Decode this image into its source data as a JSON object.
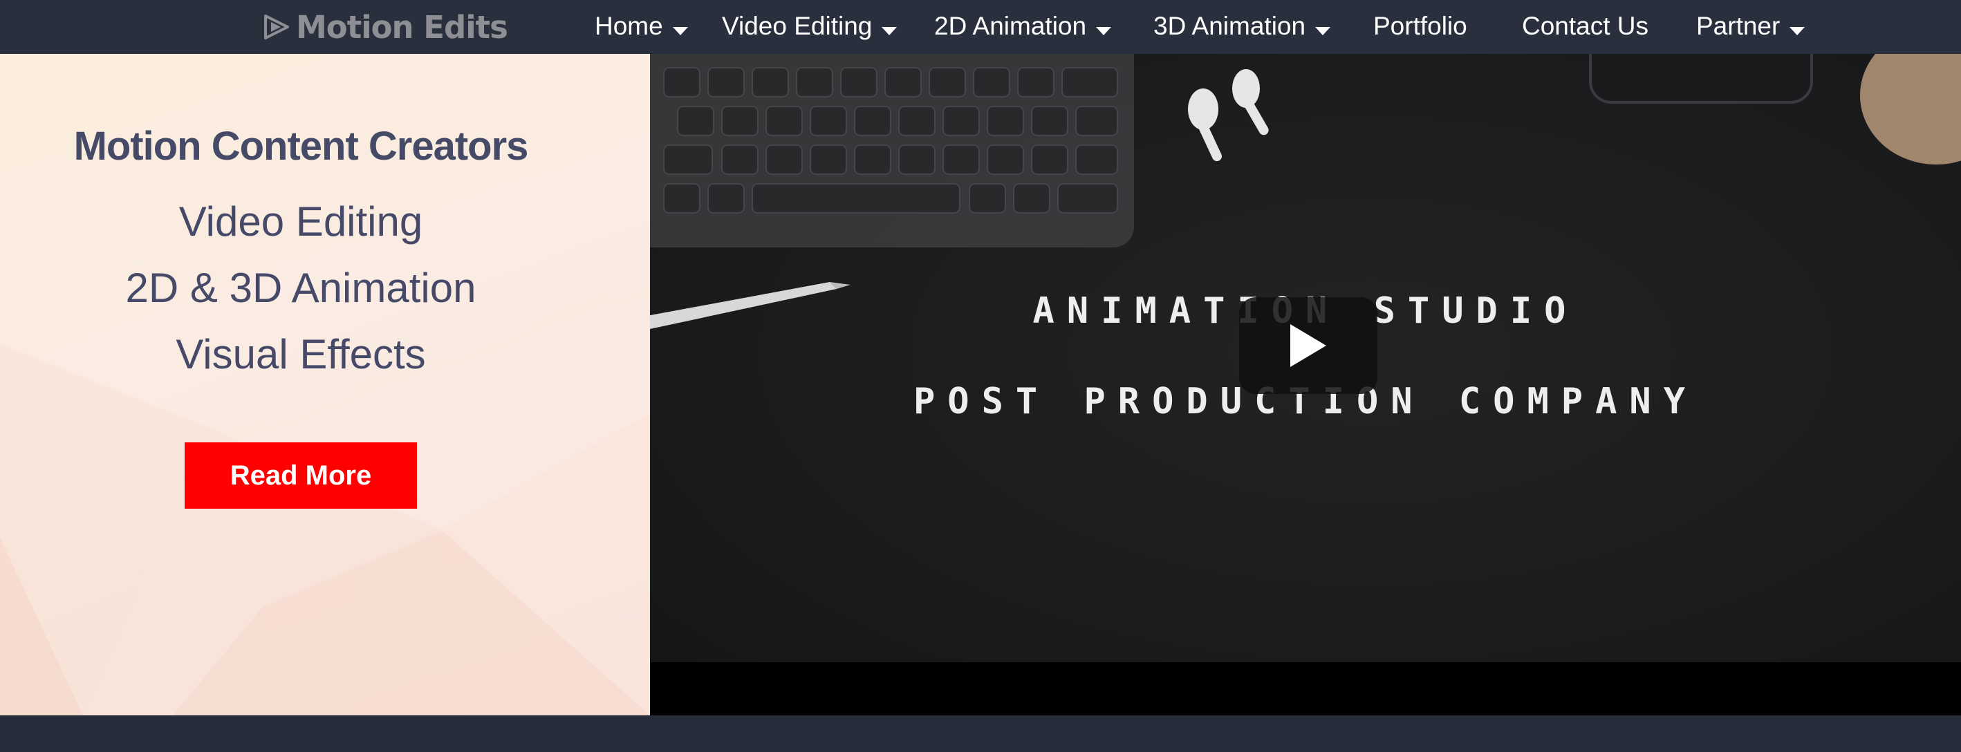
{
  "brand": {
    "name": "Motion Edits",
    "logo_icon": "play-logo-icon"
  },
  "nav": {
    "items": [
      {
        "label": "Home",
        "dropdown": true
      },
      {
        "label": "Video Editing",
        "dropdown": true
      },
      {
        "label": "2D Animation",
        "dropdown": true
      },
      {
        "label": "3D Animation",
        "dropdown": true
      },
      {
        "label": "Portfolio",
        "dropdown": false
      },
      {
        "label": "Contact Us",
        "dropdown": false
      },
      {
        "label": "Partner",
        "dropdown": true
      }
    ]
  },
  "hero": {
    "headline": "Motion Content Creators",
    "services": [
      "Video Editing",
      "2D & 3D Animation",
      "Visual Effects"
    ],
    "cta_label": "Read More"
  },
  "video": {
    "title_line1": "ANIMATION STUDIO",
    "title_line2": "POST PRODUCTION COMPANY",
    "play_icon": "play-icon"
  },
  "colors": {
    "nav_bg": "#2a2f3d",
    "text_dark": "#454a67",
    "cta_bg": "#ff0000",
    "video_bg": "#1b1c1e"
  }
}
